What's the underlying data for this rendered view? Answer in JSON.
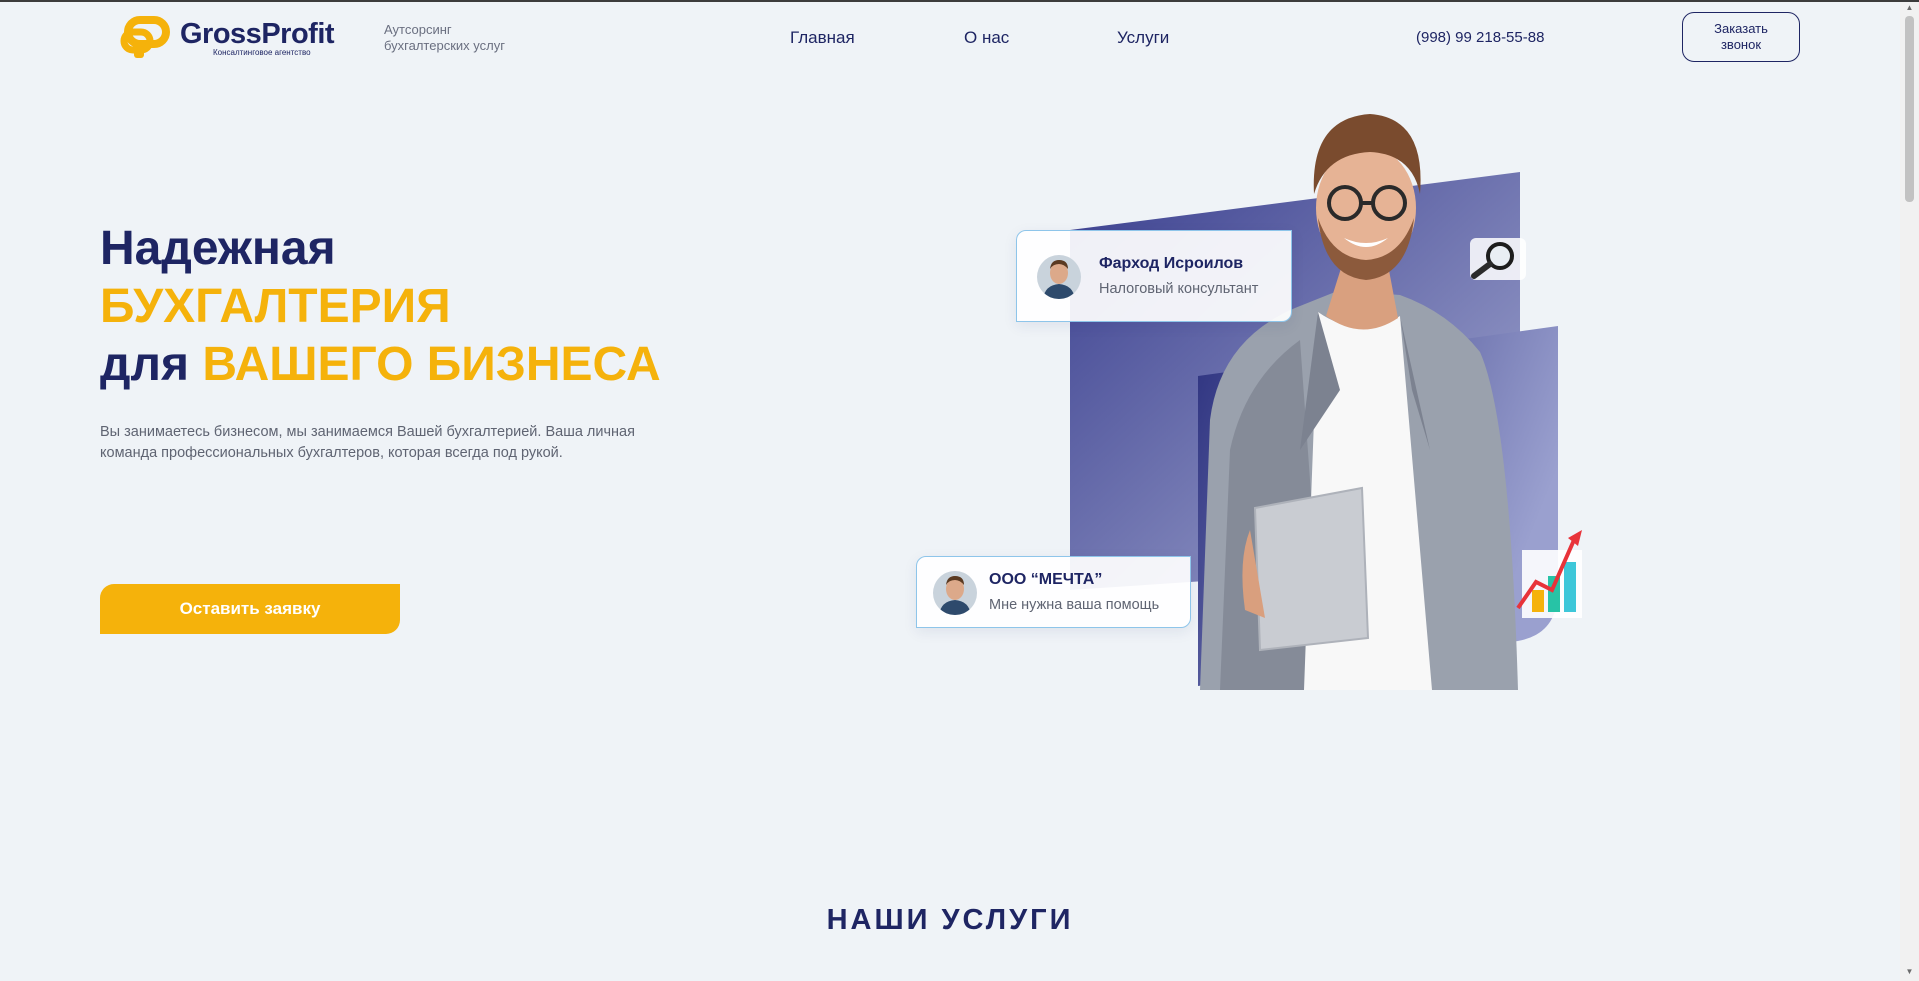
{
  "header": {
    "logo": {
      "name": "GrossProfit",
      "subtitle": "Консалтинговое агентство"
    },
    "tagline": "Аутсорсинг бухгалтерских услуг",
    "nav": [
      {
        "label": "Главная"
      },
      {
        "label": "О нас"
      },
      {
        "label": "Услуги"
      }
    ],
    "phone": "(998) 99 218-55-88",
    "call_button": "Заказать звонок"
  },
  "hero": {
    "title_line1": "Надежная",
    "title_line2": "БУХГАЛТЕРИЯ",
    "title_line3_prefix": "для",
    "title_line3_highlight": "ВАШЕГО БИЗНЕСА",
    "description": "Вы занимаетесь бизнесом, мы занимаемся Вашей бухгалтерией. Ваша личная команда профессиональных бухгалтеров, которая всегда под рукой.",
    "cta_button": "Оставить заявку"
  },
  "illustration": {
    "consultant_card": {
      "name": "Фарход Исроилов",
      "role": "Налоговый консультант"
    },
    "client_card": {
      "name": "ООО “МЕЧТА”",
      "message": "Мне нужна ваша помощь"
    }
  },
  "services": {
    "title": "НАШИ УСЛУГИ"
  },
  "colors": {
    "brand_dark": "#1e2563",
    "accent": "#f5b20b",
    "background": "#eff3f7"
  },
  "icons": [
    "logo-mark-icon",
    "magnifier-icon",
    "growth-chart-icon",
    "avatar-icon"
  ]
}
